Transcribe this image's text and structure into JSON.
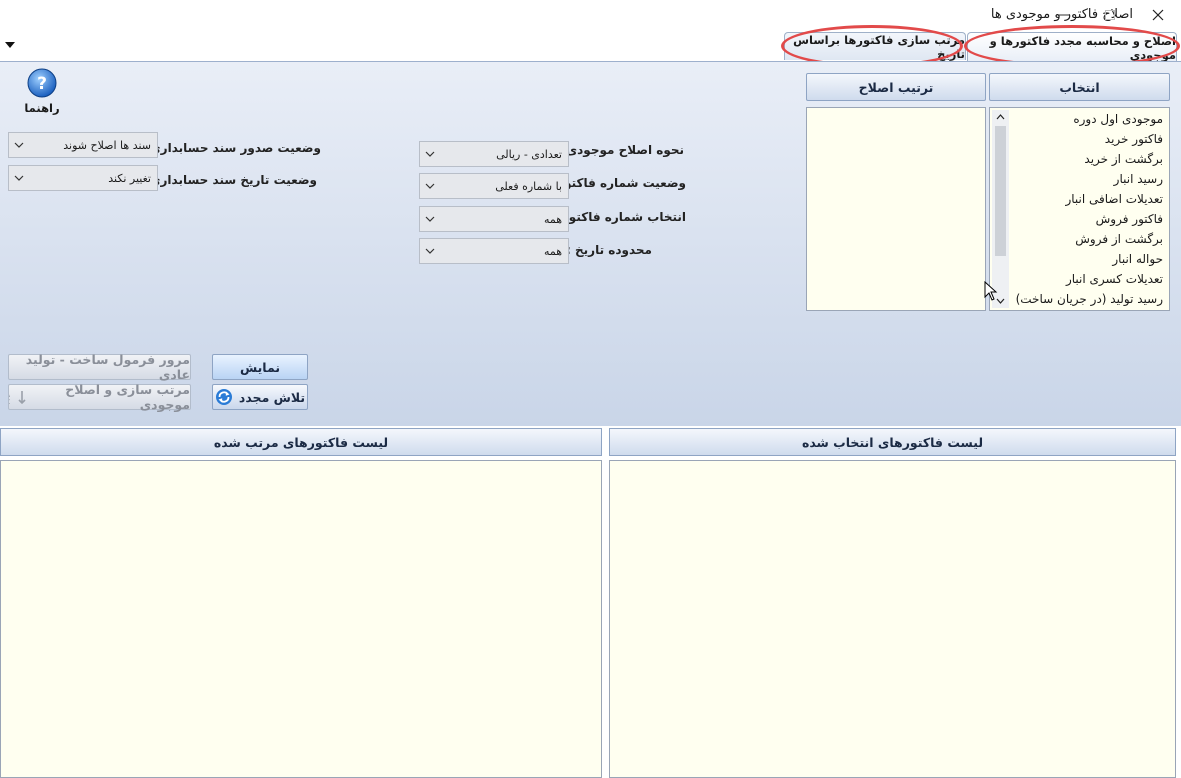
{
  "window": {
    "title": "اصلاح فاکتور و موجودی ها"
  },
  "tabs": [
    {
      "label": "اصلاح و محاسبه مجدد فاکتورها و موجودی",
      "active": true
    },
    {
      "label": "مرتب سازی فاکتورها براساس تاریخ",
      "active": false
    }
  ],
  "help": {
    "label": "راهنما"
  },
  "selection": {
    "header": "انتخاب",
    "items": [
      "موجودی اول دوره",
      "فاکتور خرید",
      "برگشت از خرید",
      "رسید انبار",
      "تعدیلات اضافی انبار",
      "فاکتور فروش",
      "برگشت از فروش",
      "حواله انبار",
      "تعدیلات کسری انبار",
      "رسید تولید (در جریان ساخت)"
    ]
  },
  "order": {
    "header": "ترتیب اصلاح"
  },
  "fields": {
    "inventory_method": {
      "label": "نحوه اصلاح موجودی :",
      "value": "تعدادی - ریالی"
    },
    "invoice_number_status": {
      "label": "وضعیت شماره فاکتور :",
      "value": "با شماره فعلی"
    },
    "invoice_number_select": {
      "label": "انتخاب شماره فاکتور :",
      "value": "همه"
    },
    "date_range": {
      "label": "محدوده تاریخ :",
      "value": "همه"
    },
    "voucher_issue_status": {
      "label": "وضعیت صدور سند حسابداری :",
      "value": "سند ها اصلاح شوند"
    },
    "voucher_date_status": {
      "label": "وضعیت تاریخ سند حسابداری :",
      "value": "تغییر نکند"
    }
  },
  "buttons": {
    "show": "نمایش",
    "retry": "تلاش مجدد",
    "review_formula": "مرور فرمول ساخت - تولید عادی",
    "sort_fix": "مرتب سازی و اصلاح موجودی"
  },
  "lists": {
    "sorted": "لیست فاکتورهای مرتب شده",
    "selected": "لیست فاکتورهای انتخاب شده"
  },
  "colors": {
    "accent_oval": "#e24a4a",
    "list_bg": "#fffff0",
    "panel_top": "#e9eef7",
    "panel_bottom": "#c9d5e8"
  }
}
